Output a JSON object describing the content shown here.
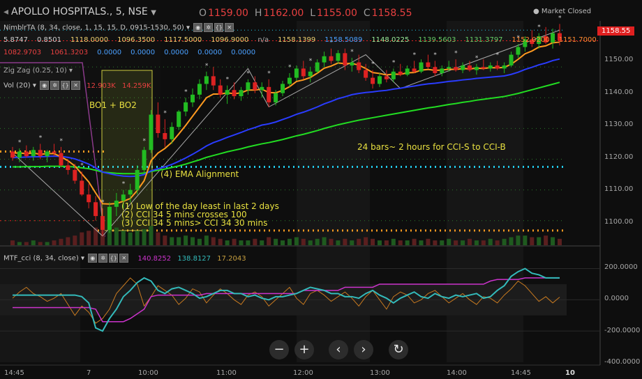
{
  "header": {
    "symbol": "APOLLO HOSPITALS., 5, NSE",
    "open_label": "O",
    "open": "1159.00",
    "high_label": "H",
    "high": "1162.00",
    "low_label": "L",
    "low": "1155.00",
    "close_label": "C",
    "close": "1158.55",
    "market_status": "Market Closed"
  },
  "indicators": {
    "nimblr_title": "NimblrTA (8, 34, close, 1, 15, 15, D, 0915-1530, 50)",
    "nimblr_row1": [
      "5.8747",
      "0.8501",
      "1118.0000",
      "1096.3500",
      "1117.5000",
      "1096.9000",
      "n/a",
      "1158.1399",
      "1158.5089",
      "1148.0225",
      "1139.5603",
      "1131.3797",
      "1152.0200",
      "1151.7000"
    ],
    "nimblr_row2": [
      "1082.9703",
      "1061.3203",
      "0.0000",
      "0.0000",
      "0.0000",
      "0.0000",
      "0.0000"
    ],
    "zigzag_title": "Zig Zag (0.25, 10)",
    "vol_title": "Vol (20)",
    "vol_values": [
      "12.903K",
      "14.259K"
    ],
    "cci_title": "MTF_cci (8, 34, close)",
    "cci_values": [
      "140.8252",
      "138.8127",
      "17.2043"
    ]
  },
  "annotations": {
    "bo": "BO1 + BO2",
    "ema": "(4) EMA Alignment",
    "bars": "24 bars~ 2 hours for CCI-S to CCI-B",
    "cond1": "(1) Low of the day least in last 2 days",
    "cond2": "(2) CCI 34 5 mins crosses 100",
    "cond3": "(3) CCI 34 5 mins> CCI 34 30 mins"
  },
  "price_axis": {
    "ticks": [
      "1150.00",
      "1140.00",
      "1130.00",
      "1120.00",
      "1110.00",
      "1100.00"
    ],
    "last_price": "1158.55"
  },
  "cci_axis": {
    "ticks": [
      "200.0000",
      "0.0000",
      "-200.0000",
      "-400.0000"
    ]
  },
  "time_axis": {
    "ticks": [
      "14:45",
      "7",
      "10:00",
      "11:00",
      "12:00",
      "13:00",
      "14:00",
      "14:45",
      "10"
    ]
  },
  "nav": {
    "zoom_out": "−",
    "zoom_in": "+",
    "prev": "‹",
    "next": "›",
    "reset": "↻"
  },
  "colors": {
    "up": "#22bb22",
    "down": "#dd2222",
    "ema_fast": "#ff9a20",
    "ema_mid": "#2a3cff",
    "ema_slow": "#22dd22",
    "cci_fast": "#cc33cc",
    "cci_slow": "#33bbbb",
    "cci_orange": "#c87a20",
    "annotation": "#e8e040"
  },
  "chart_data": {
    "type": "candlestick",
    "interval": "5 min",
    "price_range": [
      1092,
      1165
    ],
    "cci_range": [
      -400,
      260
    ],
    "candles": [
      [
        1122.5,
        1124.0,
        1119.5,
        1120.5
      ],
      [
        1120.5,
        1123.5,
        1119.0,
        1122.5
      ],
      [
        1122.5,
        1124.5,
        1120.5,
        1121.0
      ],
      [
        1121.0,
        1124.0,
        1119.5,
        1123.0
      ],
      [
        1123.0,
        1125.0,
        1120.0,
        1121.0
      ],
      [
        1121.0,
        1123.0,
        1119.0,
        1122.5
      ],
      [
        1122.5,
        1125.0,
        1121.0,
        1122.0
      ],
      [
        1122.0,
        1124.0,
        1117.5,
        1118.0
      ],
      [
        1118.0,
        1120.0,
        1115.0,
        1116.5
      ],
      [
        1116.5,
        1118.5,
        1112.0,
        1113.0
      ],
      [
        1113.0,
        1116.0,
        1108.0,
        1108.5
      ],
      [
        1108.5,
        1112.0,
        1104.0,
        1106.0
      ],
      [
        1106.0,
        1108.0,
        1100.0,
        1101.5
      ],
      [
        1101.5,
        1104.0,
        1095.0,
        1097.0
      ],
      [
        1097.0,
        1106.0,
        1096.0,
        1104.5
      ],
      [
        1104.5,
        1109.0,
        1101.5,
        1106.5
      ],
      [
        1106.5,
        1110.0,
        1104.0,
        1108.5
      ],
      [
        1108.5,
        1112.0,
        1106.0,
        1110.0
      ],
      [
        1110.0,
        1118.0,
        1108.5,
        1116.5
      ],
      [
        1116.5,
        1124.0,
        1115.5,
        1123.0
      ],
      [
        1123.0,
        1136.0,
        1122.0,
        1134.5
      ],
      [
        1134.5,
        1138.5,
        1127.0,
        1128.5
      ],
      [
        1128.5,
        1133.0,
        1124.0,
        1126.5
      ],
      [
        1126.5,
        1132.0,
        1125.0,
        1130.5
      ],
      [
        1130.5,
        1136.0,
        1129.5,
        1135.5
      ],
      [
        1135.5,
        1140.0,
        1134.0,
        1138.5
      ],
      [
        1138.5,
        1143.0,
        1137.0,
        1141.0
      ],
      [
        1141.0,
        1146.0,
        1139.5,
        1144.5
      ],
      [
        1144.5,
        1148.5,
        1142.5,
        1147.0
      ],
      [
        1147.0,
        1150.0,
        1142.5,
        1144.0
      ],
      [
        1144.0,
        1146.0,
        1140.0,
        1141.0
      ],
      [
        1141.0,
        1144.0,
        1138.0,
        1142.5
      ],
      [
        1142.5,
        1145.0,
        1139.5,
        1140.5
      ],
      [
        1140.5,
        1143.5,
        1139.0,
        1142.5
      ],
      [
        1142.5,
        1146.0,
        1141.0,
        1145.0
      ],
      [
        1145.0,
        1147.0,
        1141.5,
        1142.5
      ],
      [
        1142.5,
        1145.0,
        1140.0,
        1143.5
      ],
      [
        1143.5,
        1146.0,
        1137.0,
        1138.5
      ],
      [
        1138.5,
        1142.5,
        1137.5,
        1141.5
      ],
      [
        1141.5,
        1145.5,
        1140.5,
        1144.5
      ],
      [
        1144.5,
        1148.0,
        1143.5,
        1146.5
      ],
      [
        1146.5,
        1150.5,
        1145.5,
        1149.5
      ],
      [
        1149.5,
        1152.0,
        1146.0,
        1147.0
      ],
      [
        1147.0,
        1150.0,
        1145.0,
        1148.5
      ],
      [
        1148.5,
        1152.5,
        1148.0,
        1151.5
      ],
      [
        1151.5,
        1155.0,
        1150.0,
        1153.5
      ],
      [
        1153.5,
        1156.0,
        1151.0,
        1152.0
      ],
      [
        1152.0,
        1155.5,
        1151.0,
        1154.5
      ],
      [
        1154.5,
        1156.0,
        1149.0,
        1150.5
      ],
      [
        1150.5,
        1153.0,
        1148.5,
        1151.5
      ],
      [
        1151.5,
        1154.0,
        1148.0,
        1149.0
      ],
      [
        1149.0,
        1151.0,
        1145.5,
        1146.5
      ],
      [
        1146.5,
        1149.0,
        1143.0,
        1144.5
      ],
      [
        1144.5,
        1148.0,
        1143.5,
        1147.0
      ],
      [
        1147.0,
        1149.0,
        1145.0,
        1146.0
      ],
      [
        1146.0,
        1149.5,
        1145.0,
        1148.5
      ],
      [
        1148.5,
        1151.0,
        1147.0,
        1147.5
      ],
      [
        1147.5,
        1150.5,
        1147.0,
        1149.5
      ],
      [
        1149.5,
        1152.0,
        1148.0,
        1148.5
      ],
      [
        1148.5,
        1152.5,
        1148.0,
        1151.5
      ],
      [
        1151.5,
        1154.0,
        1149.5,
        1150.0
      ],
      [
        1150.0,
        1152.0,
        1147.0,
        1148.0
      ],
      [
        1148.0,
        1150.5,
        1147.0,
        1149.5
      ],
      [
        1149.5,
        1152.0,
        1148.5,
        1150.0
      ],
      [
        1150.0,
        1152.5,
        1148.5,
        1149.0
      ],
      [
        1149.0,
        1151.5,
        1148.0,
        1150.5
      ],
      [
        1150.5,
        1152.0,
        1148.5,
        1149.0
      ],
      [
        1149.0,
        1151.0,
        1147.5,
        1150.0
      ],
      [
        1150.0,
        1152.5,
        1149.0,
        1149.5
      ],
      [
        1149.5,
        1151.5,
        1148.5,
        1150.5
      ],
      [
        1150.5,
        1152.0,
        1149.0,
        1149.5
      ],
      [
        1149.5,
        1151.5,
        1148.0,
        1150.5
      ],
      [
        1150.5,
        1155.0,
        1150.0,
        1154.0
      ],
      [
        1154.0,
        1157.5,
        1153.0,
        1156.5
      ],
      [
        1156.5,
        1160.0,
        1155.0,
        1159.0
      ],
      [
        1159.0,
        1162.0,
        1156.5,
        1157.5
      ],
      [
        1157.5,
        1161.0,
        1156.0,
        1160.0
      ],
      [
        1160.0,
        1163.0,
        1157.5,
        1158.0
      ],
      [
        1158.0,
        1162.5,
        1156.0,
        1161.0
      ],
      [
        1161.0,
        1164.0,
        1157.0,
        1158.55
      ]
    ],
    "ema_fast": [
      1122.0,
      1122.0,
      1121.8,
      1122.0,
      1121.6,
      1121.8,
      1121.8,
      1120.8,
      1119.5,
      1117.8,
      1115.2,
      1112.6,
      1109.0,
      1105.5,
      1105.4,
      1105.6,
      1106.3,
      1107.2,
      1109.8,
      1113.0,
      1119.5,
      1122.0,
      1123.5,
      1125.5,
      1128.2,
      1131.0,
      1134.0,
      1137.0,
      1140.0,
      1141.2,
      1141.2,
      1141.6,
      1141.3,
      1141.6,
      1142.5,
      1142.5,
      1142.8,
      1141.7,
      1141.6,
      1142.4,
      1143.6,
      1145.3,
      1145.8,
      1146.6,
      1148.0,
      1149.6,
      1150.3,
      1151.3,
      1151.1,
      1151.2,
      1150.6,
      1149.5,
      1148.2,
      1147.9,
      1147.4,
      1147.7,
      1147.6,
      1148.1,
      1148.2,
      1149.0,
      1149.2,
      1148.9,
      1149.0,
      1149.3,
      1149.2,
      1149.5,
      1149.4,
      1149.6,
      1149.5,
      1149.8,
      1149.7,
      1149.9,
      1150.9,
      1152.5,
      1154.3,
      1155.2,
      1156.5,
      1156.9,
      1157.9,
      1158.1
    ],
    "ema_mid": [
      1120.5,
      1120.6,
      1120.7,
      1120.8,
      1120.8,
      1120.9,
      1121.0,
      1120.9,
      1120.6,
      1120.1,
      1119.3,
      1118.4,
      1117.2,
      1115.8,
      1115.3,
      1114.8,
      1114.5,
      1114.4,
      1114.5,
      1115.0,
      1116.2,
      1116.9,
      1117.5,
      1118.3,
      1119.3,
      1120.4,
      1121.6,
      1122.9,
      1124.3,
      1125.4,
      1126.2,
      1127.1,
      1127.9,
      1128.7,
      1129.6,
      1130.3,
      1131.1,
      1131.5,
      1132.1,
      1132.9,
      1133.7,
      1134.6,
      1135.3,
      1136.1,
      1137.0,
      1138.0,
      1138.8,
      1139.7,
      1140.3,
      1141.0,
      1141.4,
      1141.7,
      1141.9,
      1142.2,
      1142.4,
      1142.8,
      1143.1,
      1143.5,
      1143.8,
      1144.2,
      1144.5,
      1144.7,
      1145.0,
      1145.3,
      1145.5,
      1145.8,
      1146.0,
      1146.3,
      1146.5,
      1146.7,
      1146.9,
      1147.1,
      1147.6,
      1148.3,
      1149.2,
      1149.9,
      1150.7,
      1151.3,
      1152.1,
      1152.6
    ],
    "ema_slow": [
      1117.5,
      1117.5,
      1117.6,
      1117.6,
      1117.6,
      1117.7,
      1117.7,
      1117.7,
      1117.6,
      1117.5,
      1117.2,
      1116.9,
      1116.4,
      1115.8,
      1115.6,
      1115.4,
      1115.3,
      1115.3,
      1115.3,
      1115.5,
      1116.0,
      1116.4,
      1116.8,
      1117.3,
      1117.8,
      1118.4,
      1119.1,
      1119.8,
      1120.6,
      1121.2,
      1121.8,
      1122.4,
      1122.9,
      1123.4,
      1124.0,
      1124.5,
      1125.0,
      1125.4,
      1125.9,
      1126.4,
      1127.0,
      1127.6,
      1128.1,
      1128.7,
      1129.3,
      1130.0,
      1130.6,
      1131.2,
      1131.7,
      1132.2,
      1132.7,
      1133.1,
      1133.5,
      1133.9,
      1134.3,
      1134.7,
      1135.1,
      1135.5,
      1135.9,
      1136.3,
      1136.7,
      1137.0,
      1137.4,
      1137.8,
      1138.1,
      1138.5,
      1138.8,
      1139.2,
      1139.5,
      1139.8,
      1140.1,
      1140.4,
      1140.9,
      1141.4,
      1142.0,
      1142.6,
      1143.2,
      1143.8,
      1144.4,
      1145.0
    ],
    "volume": [
      3,
      2,
      2,
      3,
      2,
      2,
      3,
      4,
      5,
      6,
      8,
      9,
      11,
      13,
      12,
      11,
      9,
      8,
      9,
      10,
      12,
      8,
      6,
      5,
      5,
      6,
      5,
      4,
      6,
      5,
      4,
      3,
      4,
      3,
      3,
      4,
      3,
      5,
      4,
      3,
      4,
      5,
      4,
      3,
      4,
      5,
      4,
      3,
      4,
      3,
      4,
      5,
      4,
      3,
      3,
      4,
      3,
      3,
      4,
      3,
      4,
      3,
      3,
      4,
      3,
      3,
      4,
      3,
      3,
      4,
      3,
      4,
      5,
      6,
      6,
      5,
      5,
      6,
      5,
      4
    ],
    "cci": {
      "series": [
        {
          "name": "",
          "values": [
            -50,
            -50,
            -50,
            -50,
            -50,
            -50,
            -50,
            -50,
            -50,
            -50,
            -50,
            -50,
            -60,
            -140,
            -140,
            -140,
            -140,
            -120,
            -90,
            -60,
            20,
            30,
            30,
            30,
            30,
            30,
            30,
            30,
            40,
            40,
            40,
            40,
            40,
            40,
            40,
            40,
            40,
            40,
            40,
            40,
            40,
            40,
            60,
            60,
            60,
            60,
            60,
            60,
            80,
            80,
            80,
            80,
            80,
            100,
            100,
            100,
            100,
            100,
            100,
            100,
            100,
            100,
            100,
            100,
            100,
            100,
            100,
            100,
            100,
            120,
            130,
            130,
            130,
            130,
            140,
            140,
            140,
            140,
            140,
            139
          ]
        },
        {
          "name": "",
          "values": [
            30,
            30,
            30,
            30,
            30,
            30,
            30,
            30,
            30,
            30,
            20,
            -20,
            -180,
            -200,
            -120,
            -60,
            20,
            60,
            110,
            140,
            120,
            60,
            40,
            70,
            80,
            60,
            40,
            10,
            20,
            40,
            60,
            60,
            40,
            40,
            20,
            30,
            10,
            0,
            20,
            20,
            30,
            40,
            60,
            80,
            70,
            60,
            40,
            40,
            20,
            20,
            10,
            40,
            60,
            30,
            10,
            -20,
            10,
            30,
            50,
            20,
            10,
            40,
            20,
            10,
            30,
            20,
            30,
            40,
            10,
            20,
            60,
            90,
            150,
            180,
            200,
            170,
            160,
            140,
            140,
            140
          ]
        },
        {
          "name": "",
          "values": [
            10,
            50,
            80,
            40,
            20,
            -10,
            10,
            40,
            -30,
            -100,
            -40,
            -80,
            -150,
            -120,
            -60,
            40,
            90,
            140,
            100,
            -40,
            20,
            90,
            60,
            30,
            -30,
            10,
            70,
            50,
            -20,
            30,
            70,
            40,
            0,
            -30,
            30,
            50,
            20,
            -40,
            0,
            40,
            80,
            10,
            -30,
            40,
            60,
            30,
            -10,
            20,
            50,
            10,
            -40,
            20,
            60,
            0,
            -60,
            20,
            50,
            30,
            -20,
            0,
            40,
            60,
            20,
            -20,
            10,
            40,
            0,
            -30,
            20,
            10,
            -20,
            30,
            70,
            120,
            90,
            40,
            -10,
            20,
            -20,
            17
          ]
        }
      ]
    },
    "cci_levels": [
      100,
      -100
    ]
  }
}
